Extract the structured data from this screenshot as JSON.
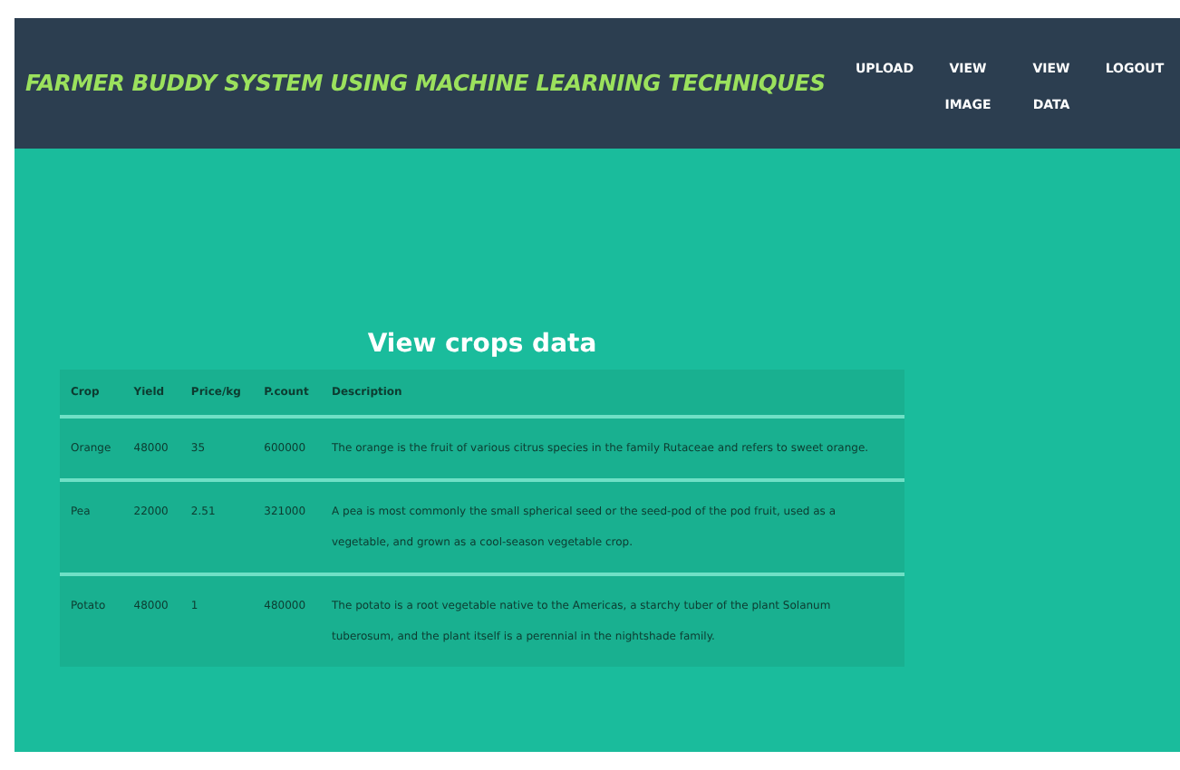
{
  "header": {
    "title": "FARMER BUDDY SYSTEM USING MACHINE LEARNING TECHNIQUES",
    "nav": [
      {
        "label": "UPLOAD"
      },
      {
        "label": "VIEW IMAGE"
      },
      {
        "label": "VIEW DATA"
      },
      {
        "label": "LOGOUT"
      }
    ]
  },
  "heading": "View crops data",
  "table": {
    "columns": [
      "Crop",
      "Yield",
      "Price/kg",
      "P.count",
      "Description"
    ],
    "rows": [
      [
        "Orange",
        "48000",
        "35",
        "600000",
        "The orange is the fruit of various citrus species in the family Rutaceae and refers to sweet orange."
      ],
      [
        "Pea",
        "22000",
        "2.51",
        "321000",
        "A pea is most commonly the small spherical seed or the seed-pod of the pod fruit, used as a vegetable, and grown as a cool-season vegetable crop."
      ],
      [
        "Potato",
        "48000",
        "1",
        "480000",
        "The potato is a root vegetable native to the Americas, a starchy tuber of the plant Solanum tuberosum, and the plant itself is a perennial in the nightshade family."
      ]
    ]
  }
}
